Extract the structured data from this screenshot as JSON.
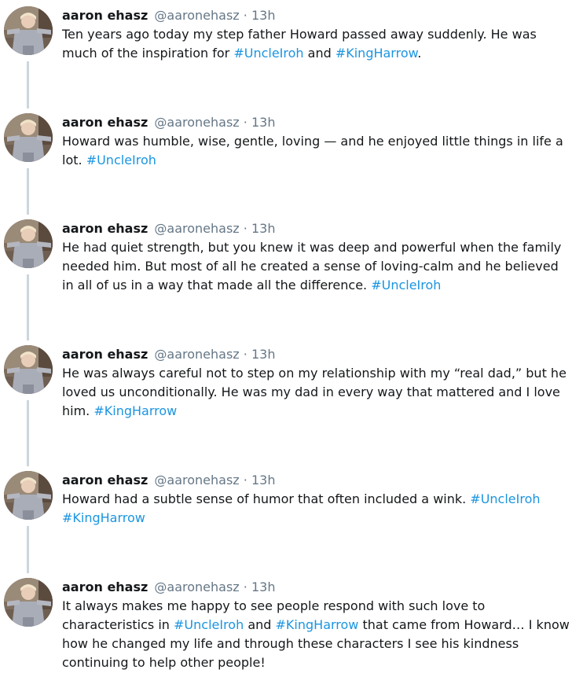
{
  "author": {
    "name": "aaron ehasz",
    "handle": "@aaronehasz",
    "separator": "·"
  },
  "colors": {
    "text": "#14171a",
    "secondary": "#657786",
    "hashtag": "#1b95e0",
    "thread_line": "#ccd6dd"
  },
  "tweets": [
    {
      "time": "13h",
      "segments": [
        {
          "type": "text",
          "text": "Ten years ago today my step father Howard passed away suddenly. He was much of the inspiration for "
        },
        {
          "type": "hashtag",
          "text": "#UncleIroh"
        },
        {
          "type": "text",
          "text": " and "
        },
        {
          "type": "hashtag",
          "text": "#KingHarrow"
        },
        {
          "type": "text",
          "text": "."
        }
      ]
    },
    {
      "time": "13h",
      "segments": [
        {
          "type": "text",
          "text": "Howard was humble, wise, gentle, loving — and he enjoyed little things in life a lot. "
        },
        {
          "type": "hashtag",
          "text": "#UncleIroh"
        }
      ]
    },
    {
      "time": "13h",
      "segments": [
        {
          "type": "text",
          "text": "He had quiet strength, but you knew it was deep and powerful when the family needed him. But most of all he created a sense of loving-calm and he believed in all of us in a way that made all the difference. "
        },
        {
          "type": "hashtag",
          "text": "#UncleIroh"
        }
      ]
    },
    {
      "time": "13h",
      "segments": [
        {
          "type": "text",
          "text": "He was always careful not to step on my relationship with my “real dad,” but he loved us unconditionally. He was my dad in every way that mattered and I love him. "
        },
        {
          "type": "hashtag",
          "text": "#KingHarrow"
        }
      ]
    },
    {
      "time": "13h",
      "segments": [
        {
          "type": "text",
          "text": "Howard had a subtle sense of humor that often included a wink. "
        },
        {
          "type": "hashtag",
          "text": "#UncleIroh"
        },
        {
          "type": "text",
          "text": " "
        },
        {
          "type": "hashtag",
          "text": "#KingHarrow"
        }
      ]
    },
    {
      "time": "13h",
      "segments": [
        {
          "type": "text",
          "text": "It always makes me happy to see people respond with such love to characteristics in "
        },
        {
          "type": "hashtag",
          "text": "#UncleIroh"
        },
        {
          "type": "text",
          "text": " and "
        },
        {
          "type": "hashtag",
          "text": "#KingHarrow"
        },
        {
          "type": "text",
          "text": " that came from Howard… I know how he changed my life and through these characters I see his kindness continuing to help other people!"
        }
      ]
    }
  ]
}
